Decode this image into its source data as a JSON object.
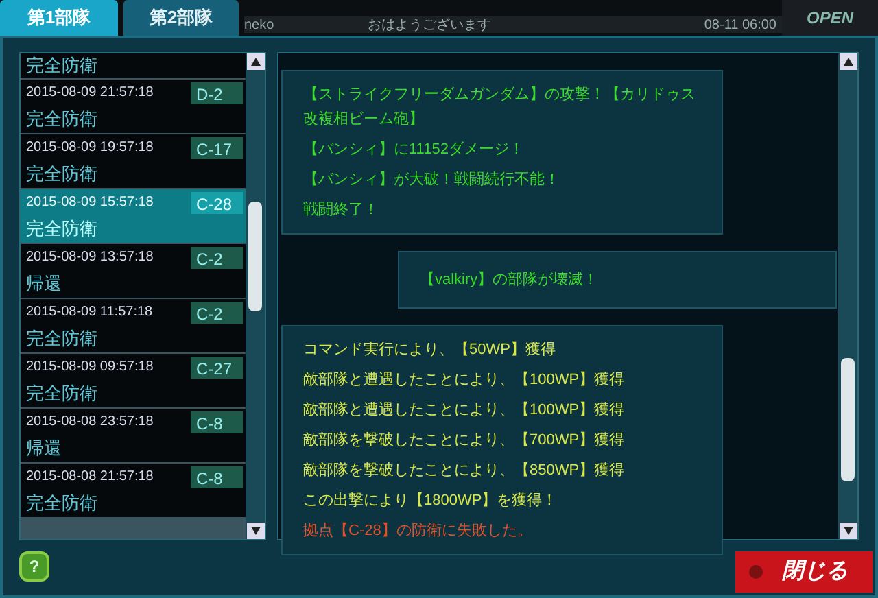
{
  "tabs": [
    {
      "label": "第1部隊",
      "selected": true
    },
    {
      "label": "第2部隊",
      "selected": false
    }
  ],
  "chat_preview": {
    "user": "neko",
    "message": "おはようございます",
    "time": "08-11 06:00",
    "open_label": "OPEN"
  },
  "history": [
    {
      "result": "完全防衛",
      "selected": false
    },
    {
      "time": "2015-08-09 21:57:18",
      "base": "D-2",
      "result": "完全防衛",
      "selected": false
    },
    {
      "time": "2015-08-09 19:57:18",
      "base": "C-17",
      "result": "完全防衛",
      "selected": false
    },
    {
      "time": "2015-08-09 15:57:18",
      "base": "C-28",
      "result": "完全防衛",
      "selected": true
    },
    {
      "time": "2015-08-09 13:57:18",
      "base": "C-2",
      "result": "帰還",
      "selected": false
    },
    {
      "time": "2015-08-09 11:57:18",
      "base": "C-2",
      "result": "完全防衛",
      "selected": false
    },
    {
      "time": "2015-08-09 09:57:18",
      "base": "C-27",
      "result": "完全防衛",
      "selected": false
    },
    {
      "time": "2015-08-08 23:57:18",
      "base": "C-8",
      "result": "帰還",
      "selected": false
    },
    {
      "time": "2015-08-08 21:57:18",
      "base": "C-8",
      "result": "完全防衛",
      "selected": false
    }
  ],
  "log": [
    {
      "kind": "battle",
      "lines": [
        {
          "text": "【ストライクフリーダムガンダム】の攻撃！【カリドゥス改複相ビーム砲】",
          "color": "#3ddc2a"
        },
        {
          "text": "【バンシィ】に11152ダメージ！",
          "color": "#3ddc2a"
        },
        {
          "text": "【バンシィ】が大破！戦闘続行不能！",
          "color": "#3ddc2a"
        },
        {
          "text": "戦闘終了！",
          "color": "#3ddc2a"
        }
      ]
    },
    {
      "kind": "notice",
      "lines": [
        {
          "text": "【valkiry】の部隊が壊滅！",
          "color": "#3ddc2a"
        }
      ]
    },
    {
      "kind": "battle",
      "lines": [
        {
          "text": "コマンド実行により、【50WP】獲得",
          "color": "#d8e84a"
        },
        {
          "text": "敵部隊と遭遇したことにより、【100WP】獲得",
          "color": "#d8e84a"
        },
        {
          "text": "敵部隊と遭遇したことにより、【100WP】獲得",
          "color": "#d8e84a"
        },
        {
          "text": "敵部隊を撃破したことにより、【700WP】獲得",
          "color": "#d8e84a"
        },
        {
          "text": "敵部隊を撃破したことにより、【850WP】獲得",
          "color": "#d8e84a"
        },
        {
          "text": "この出撃により【1800WP】を獲得！",
          "color": "#d8e84a"
        },
        {
          "text": "拠点【C-28】の防衛に失敗した。",
          "color": "#e0502a"
        }
      ]
    }
  ],
  "help_label": "?",
  "close_label": "閉じる"
}
